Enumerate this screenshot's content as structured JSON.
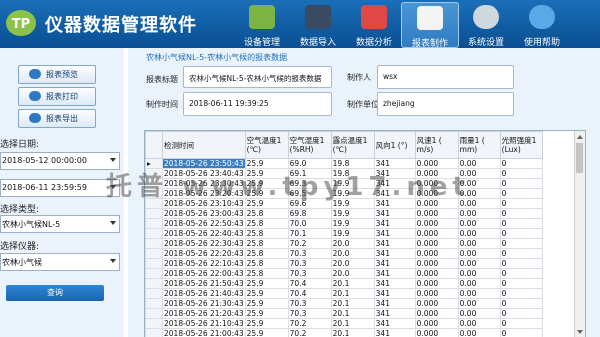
{
  "app": {
    "title": "仪器数据管理软件",
    "logo_text": "TP"
  },
  "nav": [
    {
      "label": "设备管理",
      "icon": "device-management-icon",
      "color": "#7cb342"
    },
    {
      "label": "数据导入",
      "icon": "data-import-icon",
      "color": "#3a4a63"
    },
    {
      "label": "数据分析",
      "icon": "data-analysis-icon",
      "color": "#e04848"
    },
    {
      "label": "报表制作",
      "icon": "report-document-icon",
      "color": "#f4f4f4",
      "active": true
    },
    {
      "label": "系统设置",
      "icon": "settings-gear-icon",
      "color": "#cfd8dc"
    },
    {
      "label": "使用帮助",
      "icon": "help-question-icon",
      "color": "#5aa9e6"
    }
  ],
  "sidebar": {
    "buttons": [
      {
        "label": "报表预览",
        "icon": "search-icon"
      },
      {
        "label": "报表打印",
        "icon": "printer-icon"
      },
      {
        "label": "报表导出",
        "icon": "export-icon"
      }
    ],
    "date_label": "选择日期:",
    "start_date": "2018-05-12 00:00:00",
    "end_date": "2018-06-11 23:59:59",
    "type_label": "选择类型:",
    "type_value": "农林小气候NL-5",
    "instrument_label": "选择仪器:",
    "instrument_value": "农林小气候",
    "query_label": "查询"
  },
  "report": {
    "breadcrumb": "农林小气候NL-5-农林小气候的报表数据",
    "title_label": "报表标题",
    "title_value": "农林小气候NL-5-农林小气候的报表数据",
    "maker_label": "制作人",
    "maker_value": "wsx",
    "time_label": "制作时间",
    "time_value": "2018-06-11 19:39:25",
    "unit_label": "制作单位",
    "unit_value": "zhejiang"
  },
  "table": {
    "headers": [
      "检测时间",
      "空气温度1\n(℃)",
      "空气湿度1\n(%RH)",
      "露点温度1\n(℃)",
      "风向1 (°)",
      "风速1 (\nm/s)",
      "雨量1 (\nmm)",
      "光照强度1\n(Lux)"
    ],
    "rows": [
      [
        "2018-05-26 23:50:43",
        "25.9",
        "69.0",
        "19.8",
        "341",
        "0.000",
        "0.00",
        "0"
      ],
      [
        "2018-05-26 23:40:43",
        "25.9",
        "69.1",
        "19.8",
        "341",
        "0.000",
        "0.00",
        "0"
      ],
      [
        "2018-05-26 23:30:43",
        "25.9",
        "69.3",
        "19.9",
        "341",
        "0.000",
        "0.00",
        "0"
      ],
      [
        "2018-05-26 23:20:43",
        "25.9",
        "69.5",
        "19.9",
        "341",
        "0.000",
        "0.00",
        "0"
      ],
      [
        "2018-05-26 23:10:43",
        "25.9",
        "69.6",
        "19.9",
        "341",
        "0.000",
        "0.00",
        "0"
      ],
      [
        "2018-05-26 23:00:43",
        "25.8",
        "69.8",
        "19.9",
        "341",
        "0.000",
        "0.00",
        "0"
      ],
      [
        "2018-05-26 22:50:43",
        "25.8",
        "70.0",
        "19.9",
        "341",
        "0.000",
        "0.00",
        "0"
      ],
      [
        "2018-05-26 22:40:43",
        "25.8",
        "70.1",
        "19.9",
        "341",
        "0.000",
        "0.00",
        "0"
      ],
      [
        "2018-05-26 22:30:43",
        "25.8",
        "70.2",
        "20.0",
        "341",
        "0.000",
        "0.00",
        "0"
      ],
      [
        "2018-05-26 22:20:43",
        "25.8",
        "70.3",
        "20.0",
        "341",
        "0.000",
        "0.00",
        "0"
      ],
      [
        "2018-05-26 22:10:43",
        "25.8",
        "70.3",
        "20.0",
        "341",
        "0.000",
        "0.00",
        "0"
      ],
      [
        "2018-05-26 22:00:43",
        "25.8",
        "70.3",
        "20.0",
        "341",
        "0.000",
        "0.00",
        "0"
      ],
      [
        "2018-05-26 21:50:43",
        "25.9",
        "70.4",
        "20.1",
        "341",
        "0.000",
        "0.00",
        "0"
      ],
      [
        "2018-05-26 21:40:43",
        "25.9",
        "70.4",
        "20.1",
        "341",
        "0.000",
        "0.00",
        "0"
      ],
      [
        "2018-05-26 21:30:43",
        "25.9",
        "70.3",
        "20.1",
        "341",
        "0.000",
        "0.00",
        "0"
      ],
      [
        "2018-05-26 21:20:43",
        "25.9",
        "70.3",
        "20.1",
        "341",
        "0.000",
        "0.00",
        "0"
      ],
      [
        "2018-05-26 21:10:43",
        "25.9",
        "70.2",
        "20.1",
        "341",
        "0.000",
        "0.00",
        "0"
      ],
      [
        "2018-05-26 21:00:43",
        "25.9",
        "70.2",
        "20.1",
        "341",
        "0.000",
        "0.00",
        "0"
      ]
    ],
    "selected_indicator": "▸"
  },
  "watermark": "托普 www.tpy17.net"
}
